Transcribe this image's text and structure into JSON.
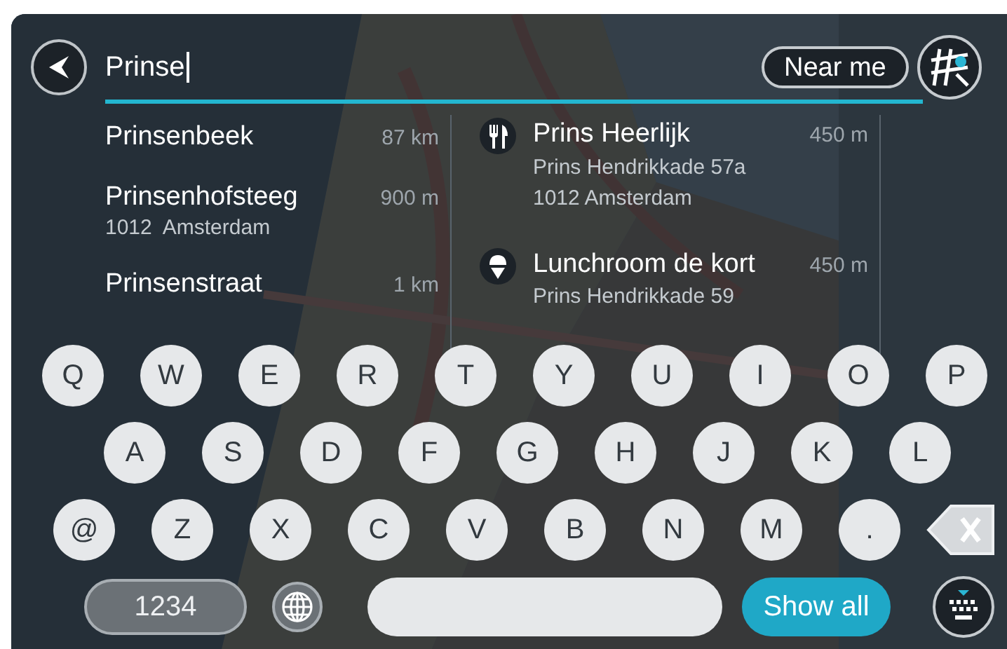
{
  "search": {
    "value": "Prinse"
  },
  "near_me_button": {
    "label": "Near me"
  },
  "results": {
    "places": [
      {
        "name": "Prinsenbeek",
        "distance": "87",
        "unit": "km"
      },
      {
        "name": "Prinsenhofsteeg",
        "distance": "900",
        "unit": "m",
        "address": "1012  Amsterdam"
      },
      {
        "name": "Prinsenstraat",
        "distance": "1",
        "unit": "km"
      }
    ],
    "points_of_interest": [
      {
        "kind": "restaurant",
        "name": "Prins Heerlijk",
        "distance": "450",
        "unit": "m",
        "address_lines": [
          "Prins Hendrikkade 57a",
          "1012 Amsterdam"
        ]
      },
      {
        "kind": "ice_cream",
        "name": "Lunchroom de kort",
        "distance": "450",
        "unit": "m",
        "address_lines": [
          "Prins Hendrikkade 59"
        ]
      }
    ]
  },
  "keyboard": {
    "rows": [
      [
        "Q",
        "W",
        "E",
        "R",
        "T",
        "Y",
        "U",
        "I",
        "O",
        "P"
      ],
      [
        "A",
        "S",
        "D",
        "F",
        "G",
        "H",
        "J",
        "K",
        "L"
      ],
      [
        "@",
        "Z",
        "X",
        "C",
        "V",
        "B",
        "N",
        "M",
        "."
      ]
    ],
    "numbers_key": "1234",
    "show_all_button": "Show all"
  }
}
